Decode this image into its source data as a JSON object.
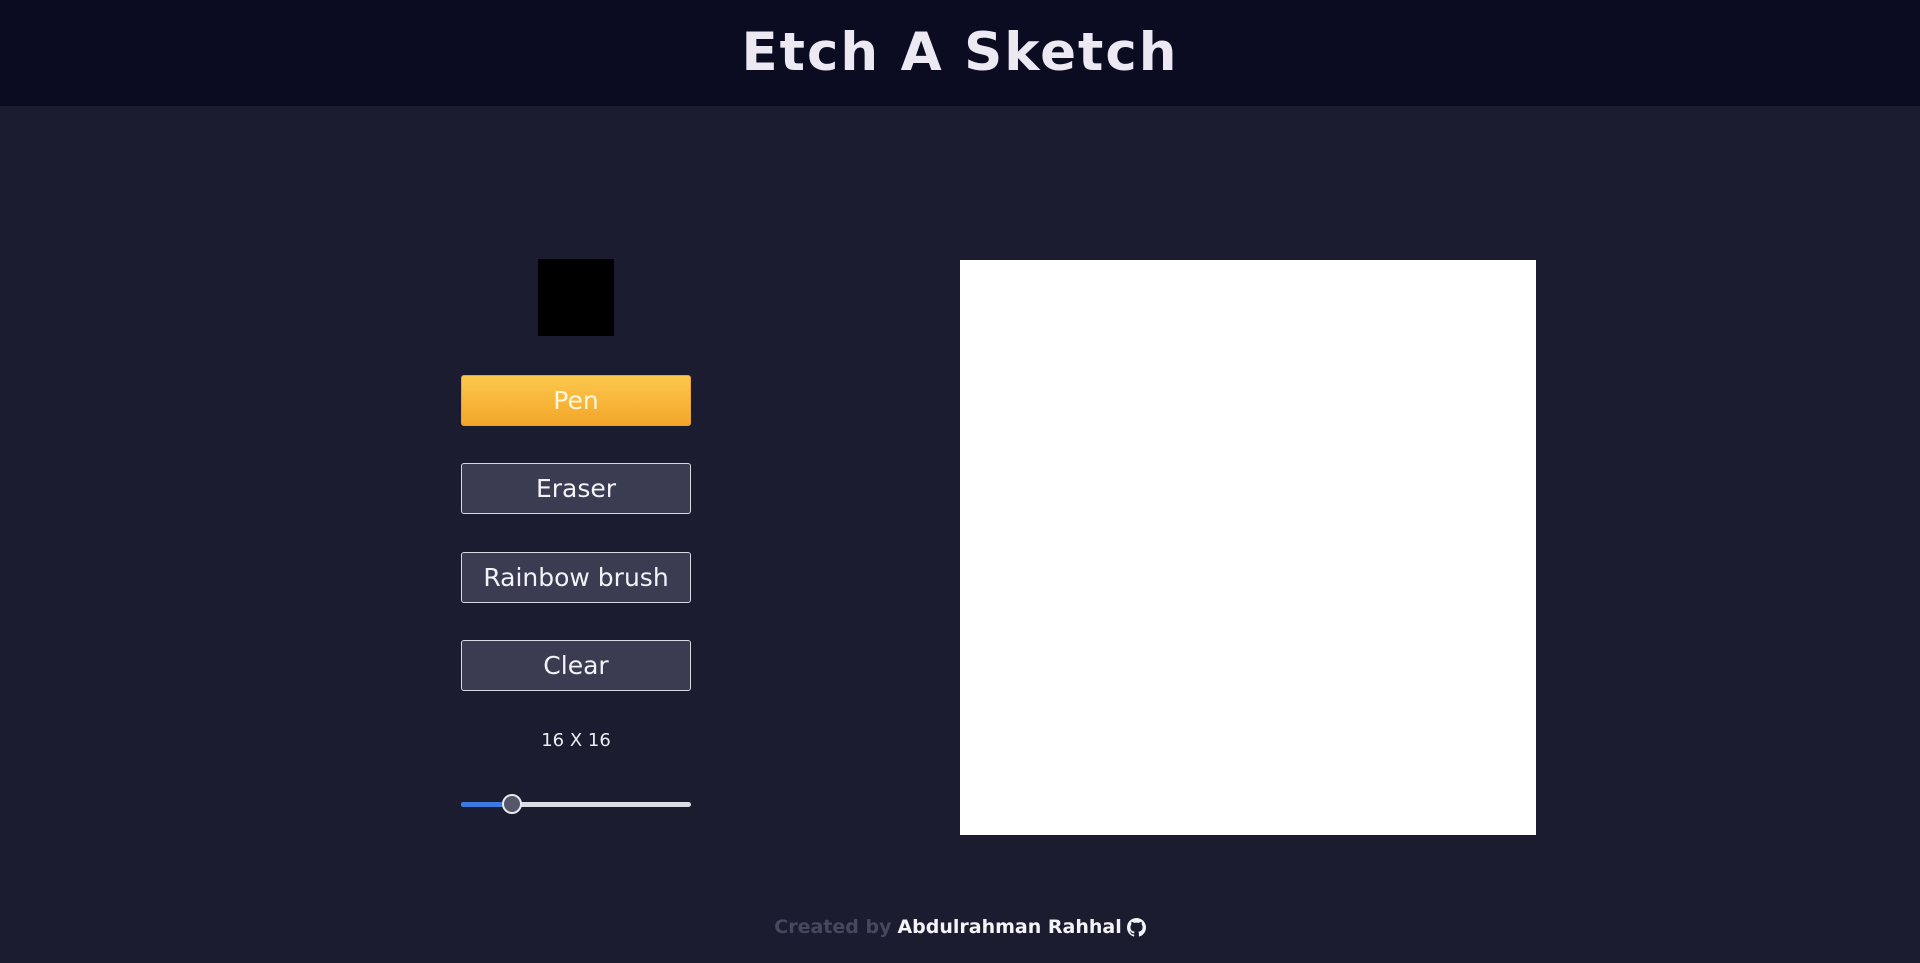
{
  "header": {
    "title": "Etch A Sketch"
  },
  "controls": {
    "current_color": "#000000",
    "buttons": [
      {
        "label": "Pen",
        "active": true
      },
      {
        "label": "Eraser",
        "active": false
      },
      {
        "label": "Rainbow brush",
        "active": false
      },
      {
        "label": "Clear",
        "active": false
      }
    ],
    "grid_size_label": "16 X 16",
    "grid_size_slider": {
      "value": 16,
      "min": 2,
      "max": 64
    }
  },
  "canvas": {
    "background": "#ffffff"
  },
  "footer": {
    "prefix": "Created by",
    "author": "Abdulrahman Rahhal",
    "icon": "github-icon"
  },
  "colors": {
    "header_bg": "#0b0c22",
    "page_bg": "#1c1c30",
    "active_button": "#f8b73a",
    "slider_accent": "#3b7ae0"
  }
}
